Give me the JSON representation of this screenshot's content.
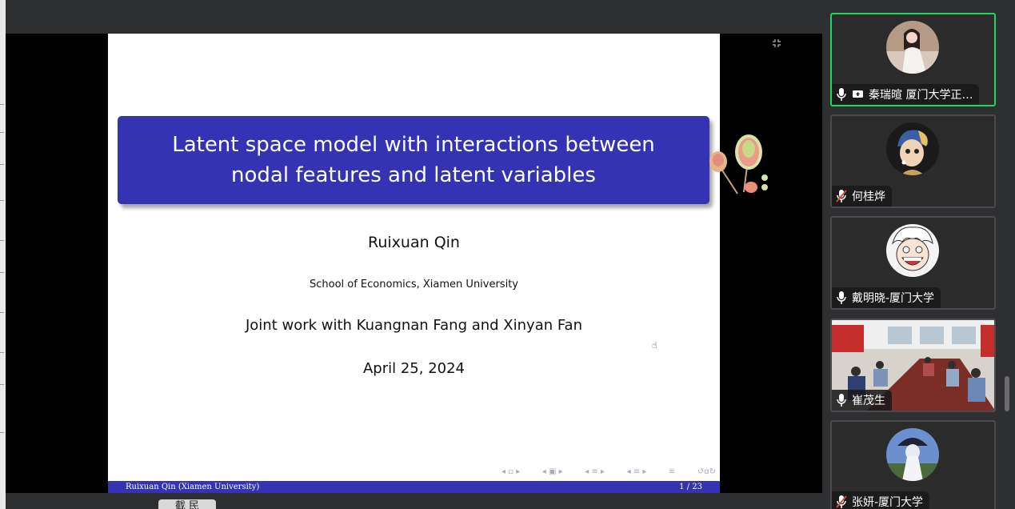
{
  "slide": {
    "title": "Latent space model with interactions between nodal features and latent variables",
    "author": "Ruixuan Qin",
    "affiliation": "School of Economics, Xiamen University",
    "joint_work": "Joint work with Kuangnan Fang and Xinyan Fan",
    "date": "April 25, 2024",
    "footer_left": "Ruixuan Qin (Xiamen University)",
    "footer_right": "1 / 23"
  },
  "participants": [
    {
      "name": "秦瑞暄 厦门大学正…",
      "mic": "on",
      "sharing": true,
      "speaking": true,
      "avatar": "avatar-woman-photo-icon"
    },
    {
      "name": "何桂烨",
      "mic": "muted",
      "sharing": false,
      "avatar": "avatar-pearl-earring-icon"
    },
    {
      "name": "戴明晓-厦门大学",
      "mic": "on",
      "sharing": false,
      "avatar": "avatar-cartoon-laughing-icon"
    },
    {
      "name": "崔茂生",
      "mic": "on",
      "sharing": false,
      "avatar": "video-meeting-room"
    },
    {
      "name": "张妍-厦门大学",
      "mic": "muted",
      "sharing": false,
      "avatar": "avatar-figure-photo-icon"
    }
  ],
  "bottom_tab": "截 民",
  "colors": {
    "accent": "#1ed760",
    "beamer_blue": "#3333b3",
    "muted_red": "#e0463e"
  }
}
